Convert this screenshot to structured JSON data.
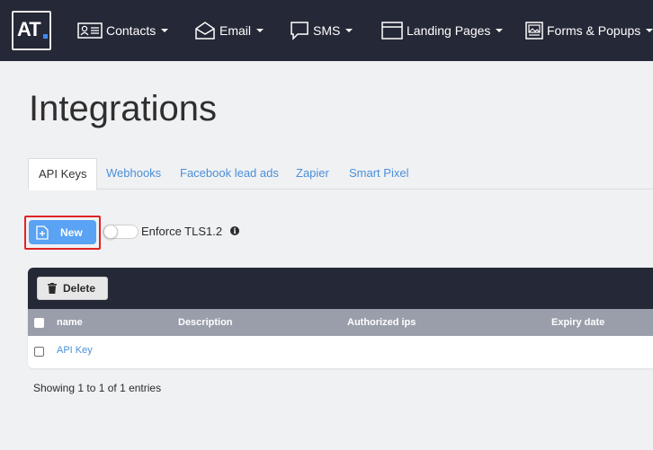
{
  "header": {
    "logo_text": "AT",
    "nav": [
      {
        "label": "Contacts",
        "icon": "contacts-icon"
      },
      {
        "label": "Email",
        "icon": "envelope-icon"
      },
      {
        "label": "SMS",
        "icon": "chat-bubble-icon"
      },
      {
        "label": "Landing Pages",
        "icon": "window-icon"
      },
      {
        "label": "Forms & Popups",
        "icon": "image-form-icon"
      }
    ]
  },
  "page": {
    "title": "Integrations"
  },
  "tabs": [
    {
      "label": "API Keys",
      "active": true
    },
    {
      "label": "Webhooks",
      "active": false
    },
    {
      "label": "Facebook lead ads",
      "active": false
    },
    {
      "label": "Zapier",
      "active": false
    },
    {
      "label": "Smart Pixel",
      "active": false
    }
  ],
  "actions": {
    "new_label": "New",
    "tls_label": "Enforce TLS1.2",
    "tls_enabled": false,
    "info_glyph": "i"
  },
  "table": {
    "delete_label": "Delete",
    "columns": [
      "name",
      "Description",
      "Authorized ips",
      "Expiry date"
    ],
    "rows": [
      {
        "name": "API Key",
        "description": "",
        "authorized_ips": "",
        "expiry_date": ""
      }
    ]
  },
  "footer": {
    "entries_text": "Showing 1 to 1 of 1 entries"
  },
  "colors": {
    "nav_bg": "#252836",
    "primary_button": "#5aa2f3",
    "link": "#4a8fd8",
    "table_header": "#9a9eaa",
    "highlight": "#e02424"
  }
}
